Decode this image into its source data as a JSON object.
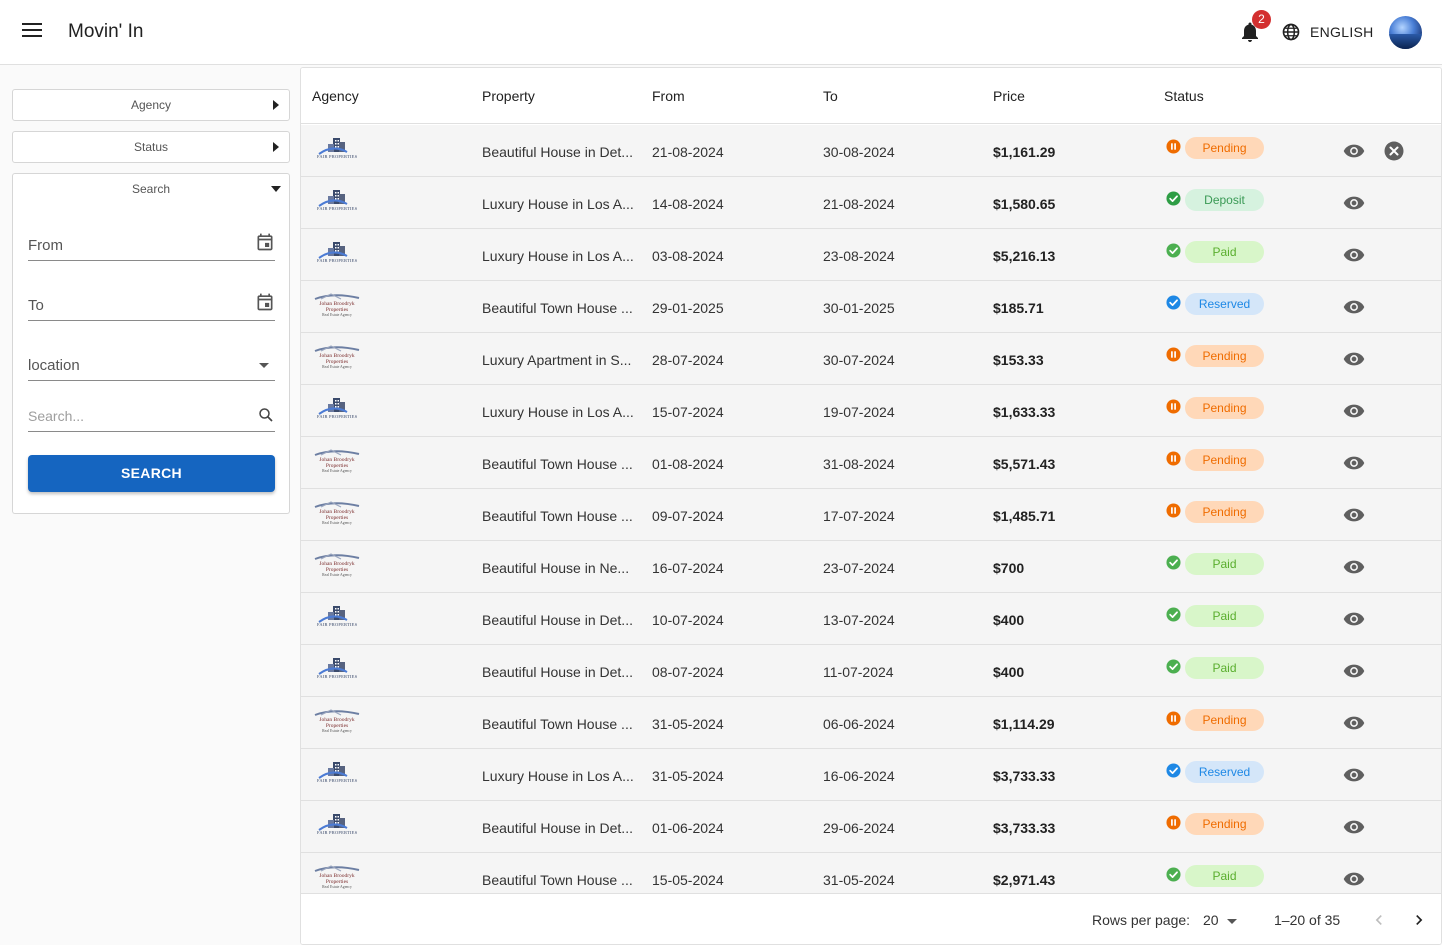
{
  "header": {
    "title": "Movin' In",
    "notification_count": "2",
    "language": "ENGLISH"
  },
  "sidebar": {
    "agency_label": "Agency",
    "status_label": "Status",
    "search_label": "Search",
    "from_label": "From",
    "to_label": "To",
    "location_label": "location",
    "search_placeholder": "Search...",
    "search_button": "SEARCH"
  },
  "table": {
    "columns": [
      "Agency",
      "Property",
      "From",
      "To",
      "Price",
      "Status"
    ],
    "rows": [
      {
        "agency_logo": "fair-properties",
        "property": "Beautiful House in Det...",
        "from": "21-08-2024",
        "to": "30-08-2024",
        "price": "$1,161.29",
        "status": "Pending",
        "cancellable": true
      },
      {
        "agency_logo": "fair-properties",
        "property": "Luxury House in Los A...",
        "from": "14-08-2024",
        "to": "21-08-2024",
        "price": "$1,580.65",
        "status": "Deposit",
        "cancellable": false
      },
      {
        "agency_logo": "fair-properties",
        "property": "Luxury House in Los A...",
        "from": "03-08-2024",
        "to": "23-08-2024",
        "price": "$5,216.13",
        "status": "Paid",
        "cancellable": false
      },
      {
        "agency_logo": "johan-broodryk",
        "property": "Beautiful Town House ...",
        "from": "29-01-2025",
        "to": "30-01-2025",
        "price": "$185.71",
        "status": "Reserved",
        "cancellable": false
      },
      {
        "agency_logo": "johan-broodryk",
        "property": "Luxury Apartment in S...",
        "from": "28-07-2024",
        "to": "30-07-2024",
        "price": "$153.33",
        "status": "Pending",
        "cancellable": false
      },
      {
        "agency_logo": "fair-properties",
        "property": "Luxury House in Los A...",
        "from": "15-07-2024",
        "to": "19-07-2024",
        "price": "$1,633.33",
        "status": "Pending",
        "cancellable": false
      },
      {
        "agency_logo": "johan-broodryk",
        "property": "Beautiful Town House ...",
        "from": "01-08-2024",
        "to": "31-08-2024",
        "price": "$5,571.43",
        "status": "Pending",
        "cancellable": false
      },
      {
        "agency_logo": "johan-broodryk",
        "property": "Beautiful Town House ...",
        "from": "09-07-2024",
        "to": "17-07-2024",
        "price": "$1,485.71",
        "status": "Pending",
        "cancellable": false
      },
      {
        "agency_logo": "johan-broodryk",
        "property": "Beautiful House in Ne...",
        "from": "16-07-2024",
        "to": "23-07-2024",
        "price": "$700",
        "status": "Paid",
        "cancellable": false
      },
      {
        "agency_logo": "fair-properties",
        "property": "Beautiful House in Det...",
        "from": "10-07-2024",
        "to": "13-07-2024",
        "price": "$400",
        "status": "Paid",
        "cancellable": false
      },
      {
        "agency_logo": "fair-properties",
        "property": "Beautiful House in Det...",
        "from": "08-07-2024",
        "to": "11-07-2024",
        "price": "$400",
        "status": "Paid",
        "cancellable": false
      },
      {
        "agency_logo": "johan-broodryk",
        "property": "Beautiful Town House ...",
        "from": "31-05-2024",
        "to": "06-06-2024",
        "price": "$1,114.29",
        "status": "Pending",
        "cancellable": false
      },
      {
        "agency_logo": "fair-properties",
        "property": "Luxury House in Los A...",
        "from": "31-05-2024",
        "to": "16-06-2024",
        "price": "$3,733.33",
        "status": "Reserved",
        "cancellable": false
      },
      {
        "agency_logo": "fair-properties",
        "property": "Beautiful House in Det...",
        "from": "01-06-2024",
        "to": "29-06-2024",
        "price": "$3,733.33",
        "status": "Pending",
        "cancellable": false
      },
      {
        "agency_logo": "johan-broodryk",
        "property": "Beautiful Town House ...",
        "from": "15-05-2024",
        "to": "31-05-2024",
        "price": "$2,971.43",
        "status": "Paid",
        "cancellable": false
      }
    ]
  },
  "status_styles": {
    "Pending": {
      "icon": "pause-icon",
      "icon_color": "#ef6c00",
      "chip_bg": "#ffd8b8",
      "chip_fg": "#ef6c00"
    },
    "Deposit": {
      "icon": "check-circle-icon",
      "icon_color": "#2e9d45",
      "chip_bg": "#d6f2df",
      "chip_fg": "#3a9a55"
    },
    "Paid": {
      "icon": "check-circle-icon",
      "icon_color": "#4caf50",
      "chip_bg": "#d8f6c9",
      "chip_fg": "#5aae2e"
    },
    "Reserved": {
      "icon": "check-circle-icon",
      "icon_color": "#1e88e5",
      "chip_bg": "#d4e6f9",
      "chip_fg": "#1e88e5"
    }
  },
  "agency_logos": {
    "fair-properties": {
      "text": "FAIR PROPERTIES"
    },
    "johan-broodryk": {
      "line1": "Johan Broodryk",
      "line2": "Properties",
      "line3": "Real Estate Agency"
    }
  },
  "pagination": {
    "rows_per_page_label": "Rows per page:",
    "rows_per_page": "20",
    "range": "1–20 of 35"
  }
}
